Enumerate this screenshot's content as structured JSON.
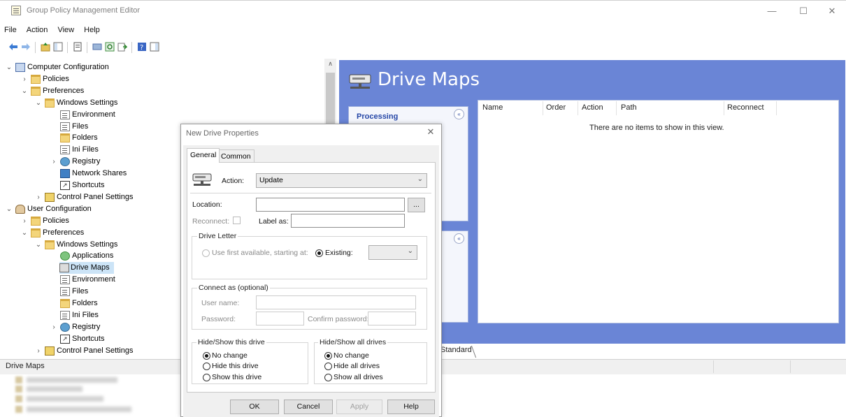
{
  "window": {
    "title": "Group Policy Management Editor",
    "controls": {
      "minimize": "—",
      "maximize": "☐",
      "close": "✕"
    }
  },
  "menu": [
    "File",
    "Action",
    "View",
    "Help"
  ],
  "toolbar": {
    "icons": [
      "back-arrow-icon",
      "forward-arrow-icon",
      "up-folder-icon",
      "show-hide-tree-icon",
      "properties-icon",
      "export-list-icon",
      "refresh-icon",
      "export-icon",
      "help-icon",
      "show-action-pane-icon"
    ]
  },
  "tree": [
    {
      "label": "Computer Configuration",
      "twisty": "v"
    },
    {
      "label": "Policies",
      "twisty": ">"
    },
    {
      "label": "Preferences",
      "twisty": "v"
    },
    {
      "label": "Windows Settings",
      "twisty": "v"
    },
    {
      "label": "Environment",
      "twisty": ""
    },
    {
      "label": "Files",
      "twisty": ""
    },
    {
      "label": "Folders",
      "twisty": ""
    },
    {
      "label": "Ini Files",
      "twisty": ""
    },
    {
      "label": "Registry",
      "twisty": ">"
    },
    {
      "label": "Network Shares",
      "twisty": ""
    },
    {
      "label": "Shortcuts",
      "twisty": ""
    },
    {
      "label": "Control Panel Settings",
      "twisty": ">"
    },
    {
      "label": "User Configuration",
      "twisty": "v"
    },
    {
      "label": "Policies",
      "twisty": ">"
    },
    {
      "label": "Preferences",
      "twisty": "v"
    },
    {
      "label": "Windows Settings",
      "twisty": "v"
    },
    {
      "label": "Applications",
      "twisty": ""
    },
    {
      "label": "Drive Maps",
      "twisty": ""
    },
    {
      "label": "Environment",
      "twisty": ""
    },
    {
      "label": "Files",
      "twisty": ""
    },
    {
      "label": "Folders",
      "twisty": ""
    },
    {
      "label": "Ini Files",
      "twisty": ""
    },
    {
      "label": "Registry",
      "twisty": ">"
    },
    {
      "label": "Shortcuts",
      "twisty": ""
    },
    {
      "label": "Control Panel Settings",
      "twisty": ">"
    }
  ],
  "tree_icons": [
    "computer-config-icon",
    "folder-icon",
    "folder-icon",
    "folder-icon",
    "environment-icon",
    "files-icon",
    "folders-icon",
    "ini-files-icon",
    "registry-icon",
    "network-shares-icon",
    "shortcuts-icon",
    "control-panel-icon",
    "user-config-icon",
    "folder-icon",
    "folder-icon",
    "folder-icon",
    "applications-icon",
    "drive-maps-icon",
    "environment-icon",
    "files-icon",
    "folders-icon",
    "ini-files-icon",
    "registry-icon",
    "shortcuts-icon",
    "control-panel-icon"
  ],
  "right_pane": {
    "title": "Drive Maps",
    "processing_label": "Processing",
    "collapse_glyph": "«",
    "columns": [
      "Name",
      "Order",
      "Action",
      "Path",
      "Reconnect"
    ],
    "empty_message": "There are no items to show in this view.",
    "tab_label": "Standard"
  },
  "statusbar": {
    "text": "Drive Maps"
  },
  "dialog": {
    "title": "New Drive Properties",
    "close": "✕",
    "tabs": [
      "General",
      "Common"
    ],
    "action_label": "Action:",
    "action_value": "Update",
    "location_label": "Location:",
    "location_value": "",
    "browse_label": "...",
    "reconnect_label": "Reconnect:",
    "label_as_label": "Label as:",
    "label_as_value": "",
    "drive_letter_legend": "Drive Letter",
    "use_first_label": "Use first available, starting at:",
    "existing_label": "Existing:",
    "drive_letter_value": "",
    "connect_as_legend": "Connect as (optional)",
    "username_label": "User name:",
    "password_label": "Password:",
    "confirm_password_label": "Confirm password:",
    "hide_show_this_legend": "Hide/Show this drive",
    "this_options": [
      "No change",
      "Hide this drive",
      "Show this drive"
    ],
    "hide_show_all_legend": "Hide/Show all drives",
    "all_options": [
      "No change",
      "Hide all drives",
      "Show all drives"
    ],
    "buttons": {
      "ok": "OK",
      "cancel": "Cancel",
      "apply": "Apply",
      "help": "Help"
    },
    "dropdown_glyph": "⌄"
  }
}
